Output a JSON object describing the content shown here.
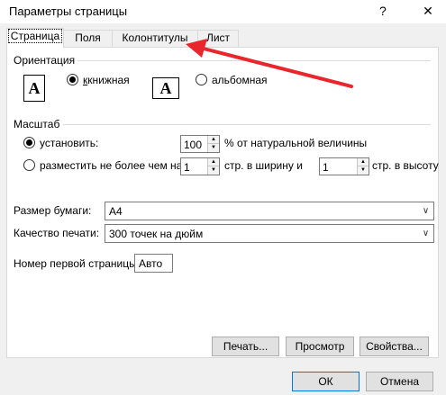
{
  "window": {
    "title": "Параметры страницы",
    "help": "?",
    "close": "✕"
  },
  "tabs": [
    {
      "label": "Страница",
      "active": true
    },
    {
      "label": "Поля",
      "active": false
    },
    {
      "label": "Колонтитулы",
      "active": false
    },
    {
      "label": "Лист",
      "active": false
    }
  ],
  "orientation": {
    "title": "Ориентация",
    "portrait_icon": "A",
    "landscape_icon": "A",
    "portrait_label": "книжная",
    "landscape_label": "альбомная",
    "selected": "portrait"
  },
  "scale": {
    "title": "Масштаб",
    "adjust_label": "установить:",
    "adjust_value": "100",
    "adjust_suffix": "% от натуральной величины",
    "fit_label": "разместить не более чем на:",
    "fit_wide_value": "1",
    "fit_wide_suffix": "стр. в ширину и",
    "fit_tall_value": "1",
    "fit_tall_suffix": "стр. в высоту",
    "selected": "adjust"
  },
  "paper": {
    "size_label": "Размер бумаги:",
    "size_value": "A4",
    "quality_label": "Качество печати:",
    "quality_value": "300 точек на дюйм",
    "first_page_label": "Номер первой страницы:",
    "first_page_value": "Авто"
  },
  "panel_buttons": {
    "print": "Печать...",
    "preview": "Просмотр",
    "options": "Свойства..."
  },
  "dialog_buttons": {
    "ok": "ОК",
    "cancel": "Отмена"
  },
  "colors": {
    "annotation_arrow": "#e8262b",
    "default_button_border": "#0078d7"
  },
  "icons": {
    "spin_up": "▲",
    "spin_down": "▼",
    "dropdown": "∨"
  }
}
